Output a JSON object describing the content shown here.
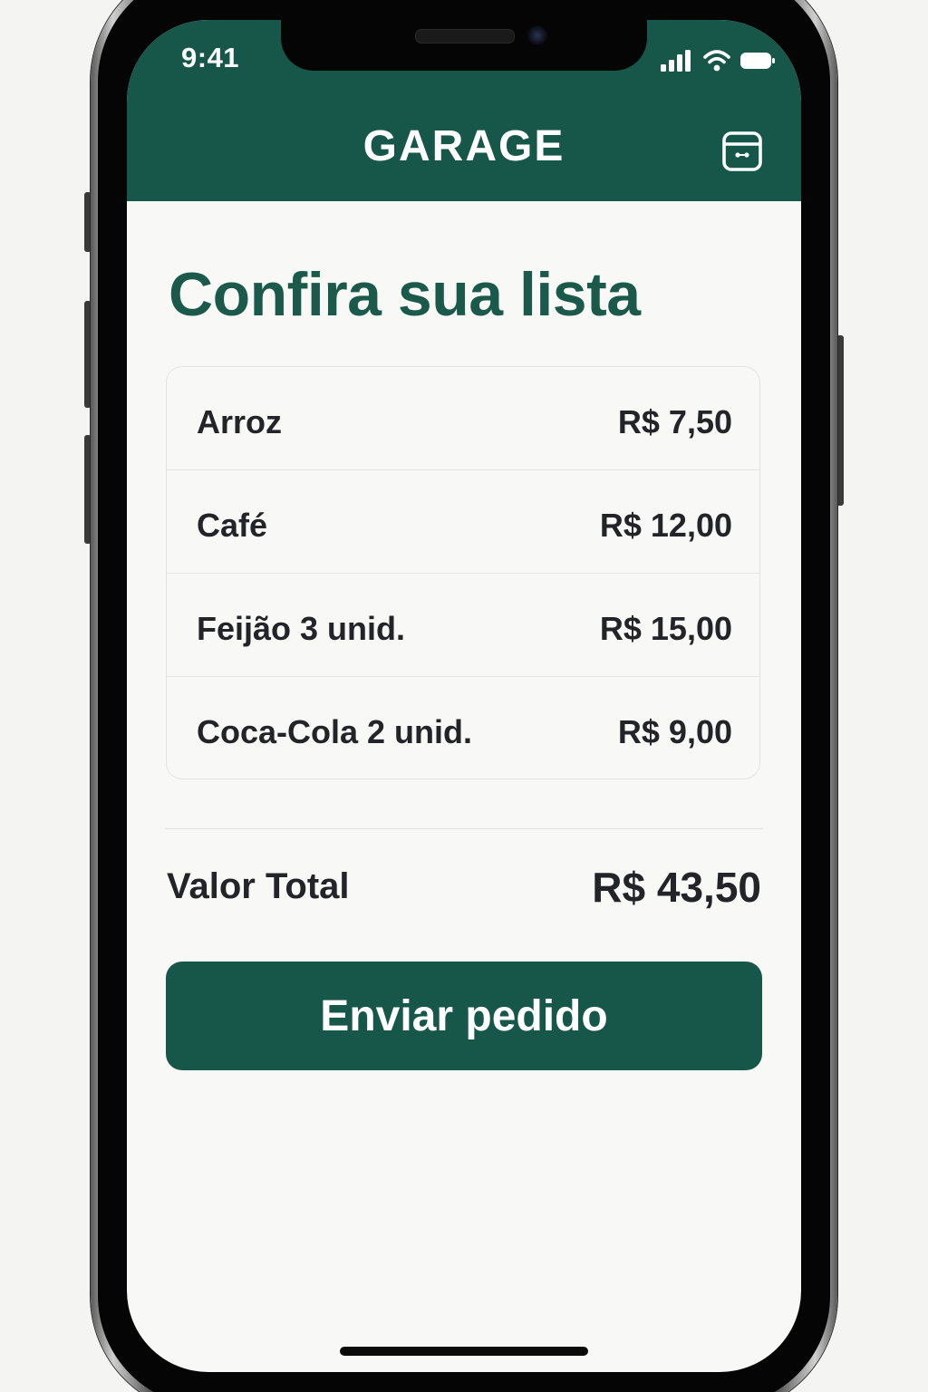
{
  "status_bar": {
    "time": "9:41",
    "icons": [
      "signal-icon",
      "wifi-icon",
      "battery-icon"
    ]
  },
  "header": {
    "title": "GARAGE",
    "background_color": "#17574a",
    "action_icon": "wallet-icon"
  },
  "main": {
    "title": "Confira sua lista",
    "title_color": "#1b5a4b",
    "items": [
      {
        "name": "Arroz",
        "price": "R$ 7,50"
      },
      {
        "name": "Café",
        "price": "R$ 12,00"
      },
      {
        "name": "Feijão 3 unid.",
        "price": "R$ 15,00"
      },
      {
        "name": "Coca-Cola 2 unid.",
        "price": "R$ 9,00"
      }
    ],
    "total_label": "Valor Total",
    "total_value": "R$ 43,50",
    "submit_label": "Enviar pedido",
    "button_color": "#17574a"
  }
}
